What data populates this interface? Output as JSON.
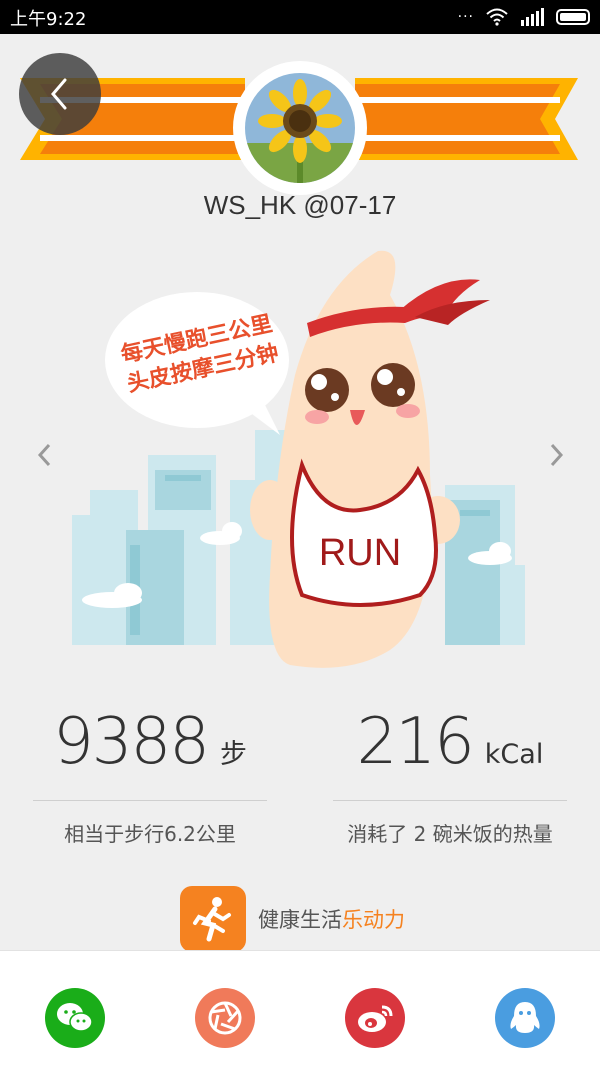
{
  "status_bar": {
    "time": "上午9:22",
    "dots": "···",
    "icons": [
      "wifi-icon",
      "signal-icon",
      "battery-icon"
    ]
  },
  "header": {
    "back_icon": "chevron-left-icon",
    "username": "WS_HK  @07-17",
    "avatar": "sunflower"
  },
  "mascot": {
    "speech_line1": "每天慢跑三公里",
    "speech_line2": "头皮按摩三分钟",
    "shirt_text": "RUN"
  },
  "stats": {
    "steps_value": "9388",
    "steps_unit": "步",
    "steps_desc": "相当于步行6.2公里",
    "calories_value": "216",
    "calories_unit": "kCal",
    "calories_desc": "消耗了 2 碗米饭的热量"
  },
  "brand": {
    "text_main": "健康生活",
    "text_accent": "乐动力",
    "accent_color": "#f58220"
  },
  "share": [
    {
      "name": "wechat",
      "color": "#1aad19"
    },
    {
      "name": "moments",
      "color": "#f07a5a"
    },
    {
      "name": "weibo",
      "color": "#d9363e"
    },
    {
      "name": "qq",
      "color": "#4a9de0"
    }
  ]
}
